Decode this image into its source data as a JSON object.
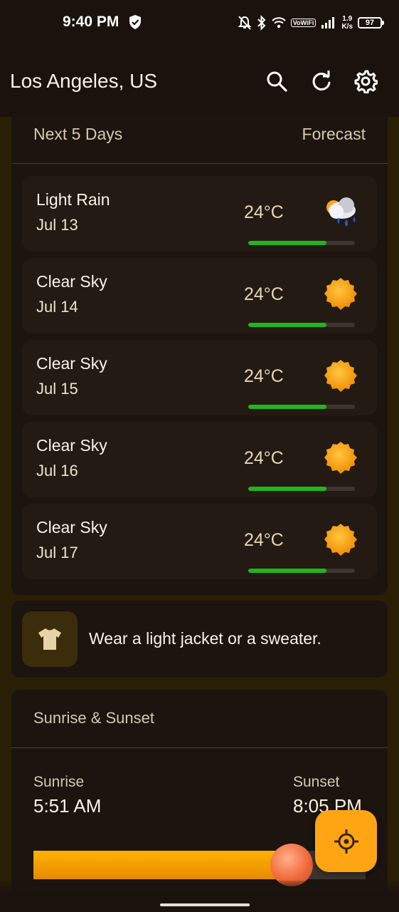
{
  "status_bar": {
    "time": "9:40 PM",
    "volte": "VoWiFi",
    "net_speed_value": "1.9",
    "net_speed_unit": "K/s",
    "battery": "97",
    "icons": [
      "shield-check-icon",
      "mute-bell-icon",
      "bluetooth-icon",
      "wifi-icon",
      "signal-icon",
      "battery-icon"
    ]
  },
  "app_bar": {
    "city": "Los Angeles, US",
    "actions": [
      "search-icon",
      "refresh-icon",
      "gear-icon"
    ]
  },
  "forecast": {
    "title": "Next 5 Days",
    "subtitle": "Forecast",
    "days": [
      {
        "condition": "Light Rain",
        "date": "Jul 13",
        "temp": "24°C",
        "icon": "rain-cloud-icon",
        "bar_fraction": 0.73
      },
      {
        "condition": "Clear Sky",
        "date": "Jul 14",
        "temp": "24°C",
        "icon": "sun-icon",
        "bar_fraction": 0.73
      },
      {
        "condition": "Clear Sky",
        "date": "Jul 15",
        "temp": "24°C",
        "icon": "sun-icon",
        "bar_fraction": 0.73
      },
      {
        "condition": "Clear Sky",
        "date": "Jul 16",
        "temp": "24°C",
        "icon": "sun-icon",
        "bar_fraction": 0.73
      },
      {
        "condition": "Clear Sky",
        "date": "Jul 17",
        "temp": "24°C",
        "icon": "sun-icon",
        "bar_fraction": 0.73
      }
    ]
  },
  "clothing_tip": {
    "icon": "tshirt-icon",
    "text": "Wear a light jacket or a sweater."
  },
  "sun": {
    "title": "Sunrise & Sunset",
    "sunrise_label": "Sunrise",
    "sunrise_time": "5:51 AM",
    "sunset_label": "Sunset",
    "sunset_time": "8:05 PM",
    "progress_fraction": 0.8
  },
  "fab": {
    "icon": "crosshair-location-icon"
  },
  "colors": {
    "accent": "#ffa514",
    "temp_bar": "#22b51d",
    "card_bg": "#1b140f",
    "page_bg": "#2a1f05"
  }
}
